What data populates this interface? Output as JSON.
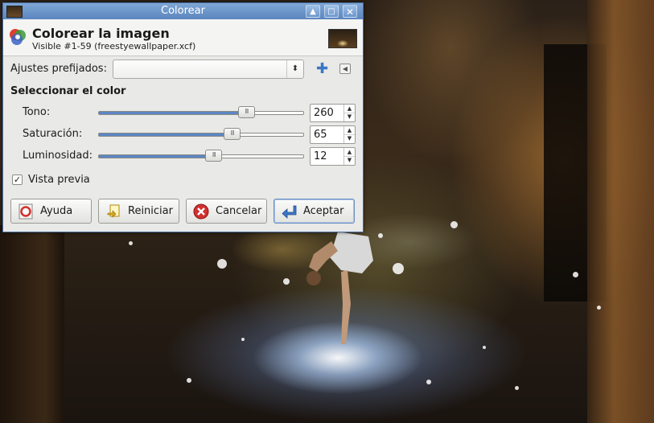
{
  "window": {
    "title": "Colorear"
  },
  "header": {
    "title": "Colorear la imagen",
    "subtitle": "Visible #1-59 (freestyewallpaper.xcf)"
  },
  "presets": {
    "label": "Ajustes prefijados:",
    "value": ""
  },
  "section": {
    "title": "Seleccionar el color"
  },
  "sliders": [
    {
      "label": "Tono:",
      "value": "260",
      "level": 0.72
    },
    {
      "label": "Saturación:",
      "value": "65",
      "level": 0.65
    },
    {
      "label": "Luminosidad:",
      "value": "12",
      "level": 0.56
    }
  ],
  "preview": {
    "label": "Vista previa",
    "checked": true
  },
  "buttons": {
    "help": "Ayuda",
    "reset": "Reiniciar",
    "cancel": "Cancelar",
    "ok": "Aceptar"
  },
  "colors": {
    "titlebar": "#5b86bf",
    "slider_fill": "#5b86c4",
    "cancel_icon": "#d23030"
  }
}
